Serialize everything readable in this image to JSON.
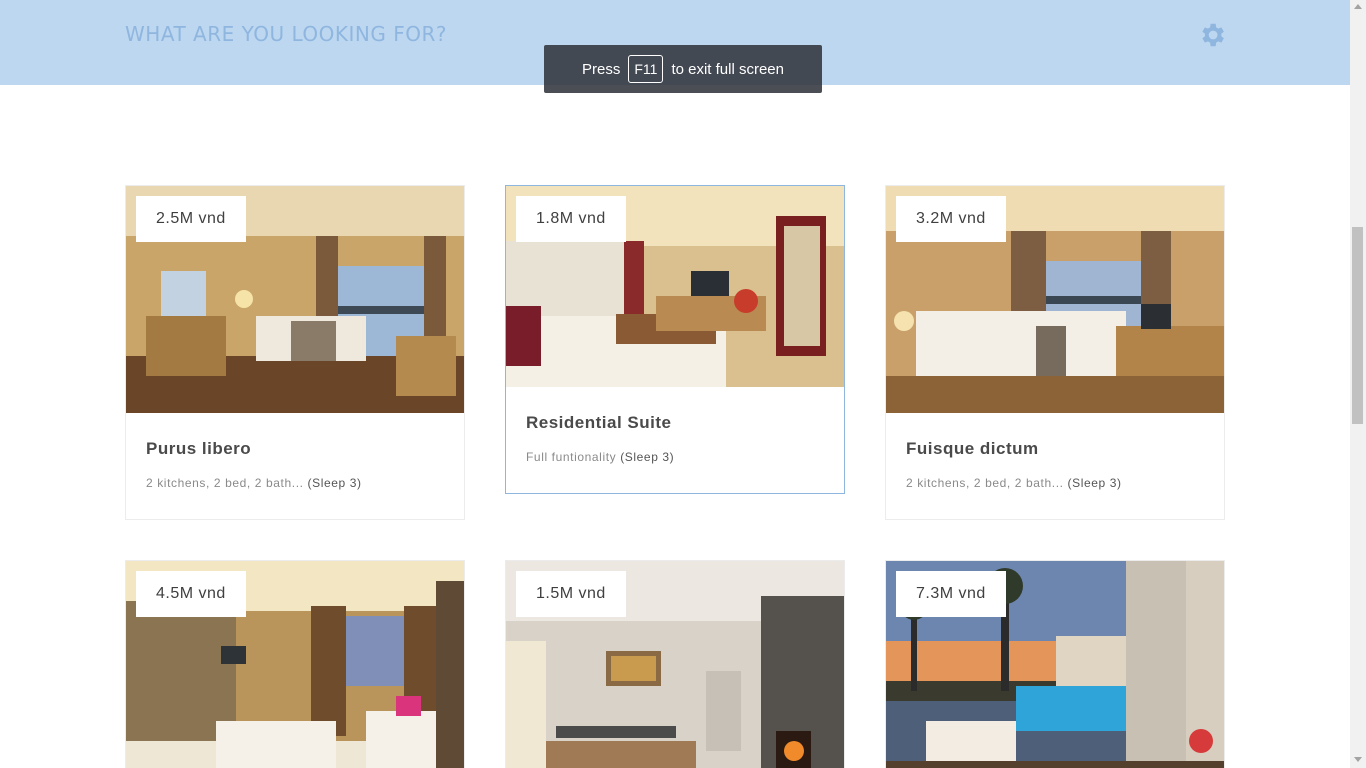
{
  "header": {
    "title": "WHAT ARE YOU LOOKING FOR?",
    "gear_icon": "gear-icon",
    "background": "#bdd7f0"
  },
  "toast": {
    "press": "Press",
    "key": "F11",
    "suffix": "to exit full screen"
  },
  "rooms": [
    {
      "price": "2.5M vnd",
      "name": "Purus libero",
      "desc": "2 kitchens, 2 bed, 2 bath...",
      "sleep": "(Sleep 3)"
    },
    {
      "price": "1.8M vnd",
      "name": "Residential Suite",
      "desc": "Full funtionality",
      "sleep": "(Sleep 3)"
    },
    {
      "price": "3.2M vnd",
      "name": "Fuisque dictum",
      "desc": "2 kitchens, 2 bed, 2 bath...",
      "sleep": "(Sleep 3)"
    },
    {
      "price": "4.5M vnd"
    },
    {
      "price": "1.5M vnd"
    },
    {
      "price": "7.3M vnd"
    }
  ]
}
